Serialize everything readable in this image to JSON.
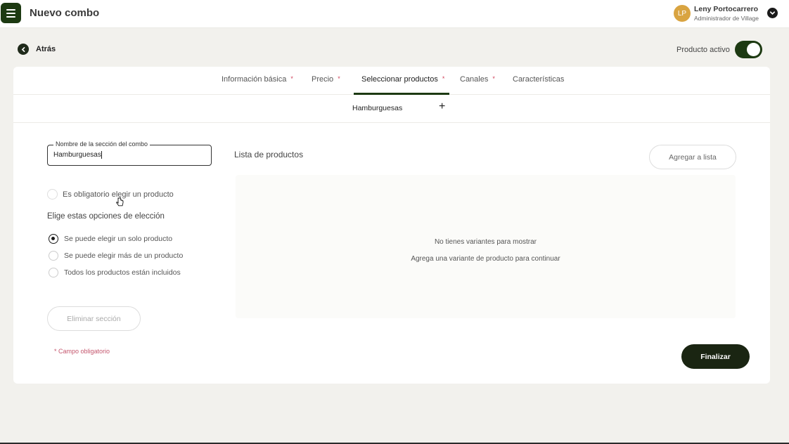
{
  "header": {
    "title": "Nuevo combo",
    "user": {
      "initials": "LP",
      "name": "Leny Portocarrero",
      "role": "Administrador de Village"
    }
  },
  "nav": {
    "back_label": "Atrás",
    "active_label": "Producto activo",
    "active_on": true
  },
  "tabs": [
    {
      "label": "Información básica",
      "required": "*"
    },
    {
      "label": "Precio",
      "required": "*"
    },
    {
      "label": "Seleccionar productos",
      "required": "*",
      "active": true
    },
    {
      "label": "Canales",
      "required": "*"
    },
    {
      "label": "Características",
      "required": ""
    }
  ],
  "sections": {
    "current": "Hamburguesas",
    "add_symbol": "+"
  },
  "form": {
    "name_legend": "Nombre de la sección del combo",
    "name_value": "Hamburguesas",
    "mandatory_label": "Es obligatorio elegir un producto",
    "choice_title": "Elige estas opciones de elección",
    "options": [
      {
        "label": "Se puede elegir un solo producto",
        "selected": true
      },
      {
        "label": "Se puede elegir más de un producto",
        "selected": false
      },
      {
        "label": "Todos los productos están incluidos",
        "selected": false
      }
    ],
    "delete_label": "Eliminar sección",
    "required_note": "* Campo obligatorio"
  },
  "list": {
    "title": "Lista de productos",
    "add_label": "Agregar a lista",
    "empty_title": "No tienes variantes para mostrar",
    "empty_sub": "Agrega una variante de producto para continuar"
  },
  "finish_label": "Finalizar",
  "colors": {
    "brand": "#1d3a12",
    "accent_required": "#d0435b",
    "avatar": "#d9a441"
  }
}
